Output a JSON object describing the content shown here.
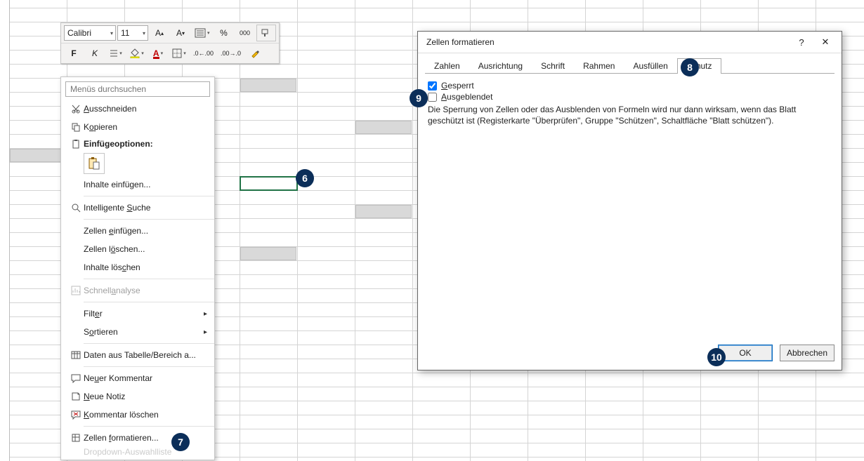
{
  "mini_toolbar": {
    "font_name": "Calibri",
    "font_size": "11",
    "percent_label": "%",
    "thousand_label": "000"
  },
  "context_menu": {
    "search_placeholder": "Menüs durchsuchen",
    "cut": "Ausschneiden",
    "copy": "Kopieren",
    "paste_options": "Einfügeoptionen:",
    "paste_special": "Inhalte einfügen...",
    "smart_lookup": "Intelligente Suche",
    "insert_cells": "Zellen einfügen...",
    "delete_cells": "Zellen löschen...",
    "clear_contents": "Inhalte löschen",
    "quick_analysis": "Schnellanalyse",
    "filter": "Filter",
    "sort": "Sortieren",
    "from_table": "Daten aus Tabelle/Bereich a...",
    "new_comment": "Neuer Kommentar",
    "new_note": "Neue Notiz",
    "delete_comment": "Kommentar löschen",
    "format_cells": "Zellen formatieren...",
    "dropdown": "Dropdown-Auswahlliste"
  },
  "dialog": {
    "title": "Zellen formatieren",
    "tabs": [
      "Zahlen",
      "Ausrichtung",
      "Schrift",
      "Rahmen",
      "Ausfüllen",
      "Schutz"
    ],
    "active_tab": 5,
    "locked_label": "Gesperrt",
    "locked_checked": true,
    "hidden_label": "Ausgeblendet",
    "hidden_checked": false,
    "info_text": "Die Sperrung von Zellen oder das Ausblenden von Formeln wird nur dann wirksam, wenn das Blatt geschützt ist (Registerkarte \"Überprüfen\", Gruppe \"Schützen\", Schaltfläche \"Blatt schützen\").",
    "ok": "OK",
    "cancel": "Abbrechen",
    "close_glyph": "✕",
    "help_glyph": "?"
  },
  "badges": {
    "b6": "6",
    "b7": "7",
    "b8": "8",
    "b9": "9",
    "b10": "10"
  }
}
